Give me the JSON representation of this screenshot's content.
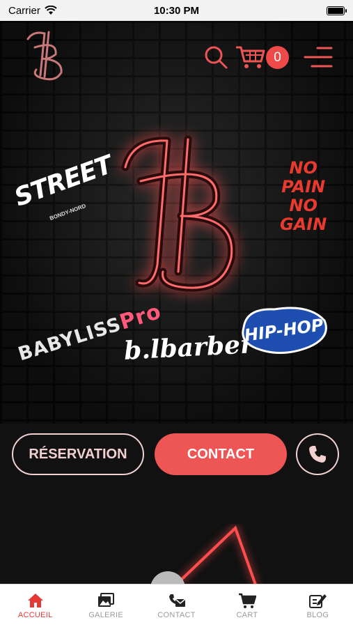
{
  "status_bar": {
    "carrier": "Carrier",
    "time": "10:30 PM"
  },
  "header": {
    "cart_count": "0"
  },
  "stickers": {
    "street": "STREET",
    "street_sub": "BONDY-NORD",
    "nopain": [
      "NO",
      "PAIN",
      "NO",
      "GAIN"
    ],
    "babyliss": "BABYLISS",
    "babyliss_pro": "Pro",
    "blbarber": "b.lbarber",
    "hiphop": "HIP-HOP"
  },
  "buttons": {
    "reservation": "RÉSERVATION",
    "contact": "CONTACT"
  },
  "colors": {
    "accent": "#ee5555",
    "active_tab": "#e53935",
    "neon": "#ff4d4d"
  },
  "tabs": [
    {
      "label": "ACCUEIL",
      "icon": "home-icon"
    },
    {
      "label": "GALERIE",
      "icon": "gallery-icon"
    },
    {
      "label": "CONTACT",
      "icon": "mail-icon"
    },
    {
      "label": "CART",
      "icon": "cart-icon"
    },
    {
      "label": "BLOG",
      "icon": "edit-icon"
    }
  ]
}
